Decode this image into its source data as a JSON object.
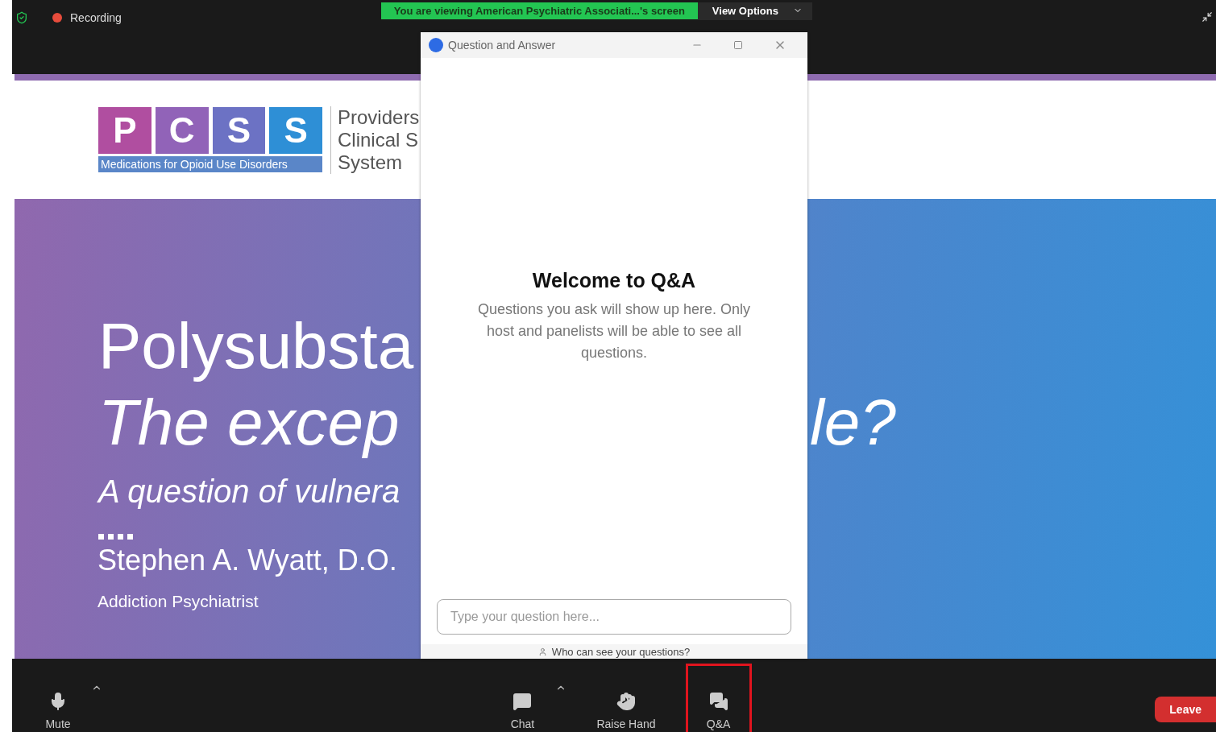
{
  "top_bar": {
    "recording": "Recording",
    "banner": "You are viewing American Psychiatric Associati...'s screen",
    "view_options": "View Options"
  },
  "slide": {
    "logo_letters": [
      "P",
      "C",
      "S",
      "S"
    ],
    "logo_tagline": "Medications for Opioid Use Disorders",
    "logo_name_lines": [
      "Providers",
      "Clinical S",
      "System"
    ],
    "title": "Polysubsta",
    "subtitle_left": "The excep",
    "subtitle_right": "le?",
    "question": "A question of vulnera",
    "presenter": "Stephen A. Wyatt, D.O.",
    "role": "Addiction Psychiatrist"
  },
  "qa_window": {
    "title": "Question and Answer",
    "heading": "Welcome to Q&A",
    "message": "Questions you ask will show up here. Only host and panelists will be able to see all questions.",
    "input": {
      "placeholder": "Type your question here..."
    },
    "footer_link": "Who can see your questions?"
  },
  "toolbar": {
    "left": [
      {
        "label": "Mute",
        "kind": "mic",
        "menu": true,
        "selected": false
      }
    ],
    "center": [
      {
        "label": "Chat",
        "kind": "chat",
        "menu": true,
        "selected": false
      },
      {
        "label": "Raise Hand",
        "kind": "hand",
        "menu": false,
        "selected": false
      },
      {
        "label": "Q&A",
        "kind": "qa",
        "menu": false,
        "selected": true
      }
    ],
    "leave": "Leave"
  }
}
